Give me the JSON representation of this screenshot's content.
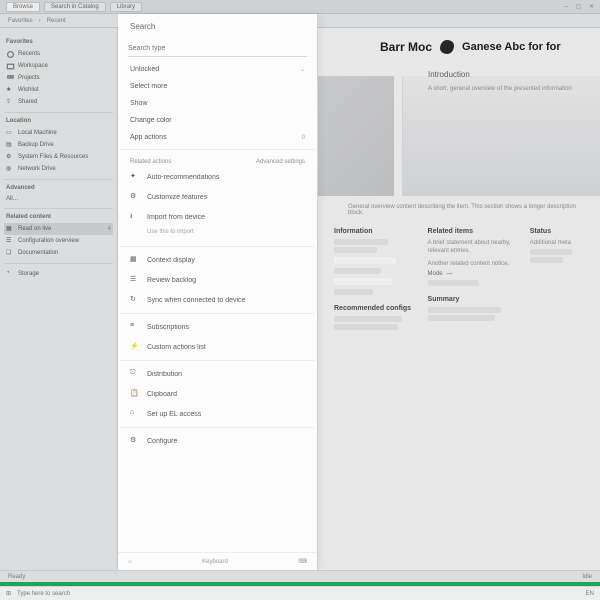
{
  "tabbar": {
    "tab1": "Browse",
    "tab2": "Search in Catalog",
    "tab3": "Library"
  },
  "toolbar": {
    "breadcrumb1": "Favorites",
    "breadcrumb2": "Recent"
  },
  "sidebar": {
    "group1_title": "Favorites",
    "items1": [
      {
        "label": "Recents"
      },
      {
        "label": "Workspace"
      },
      {
        "label": "Projects"
      },
      {
        "label": "Wishlist"
      },
      {
        "label": "Shared"
      }
    ],
    "group2_title": "Location",
    "items2": [
      {
        "label": "Local Machine"
      },
      {
        "label": "Backup Drive"
      },
      {
        "label": "System Files & Resources"
      },
      {
        "label": "Network Drive"
      }
    ],
    "group3_title": "Advanced",
    "items3": [
      {
        "label": "All…"
      }
    ],
    "group4_title": "Related content",
    "items4": [
      {
        "label": "Read on live",
        "meta": "4"
      },
      {
        "label": "Configuration overview"
      },
      {
        "label": "Documentation"
      }
    ],
    "bottom_label": "Storage"
  },
  "menu": {
    "title": "Search",
    "search_placeholder": "Search type",
    "item_unlocked": "Unlocked",
    "item_select_more": "Select more",
    "item_show": "Show",
    "item_changecolor": "Change color",
    "item_app_actions": "App actions",
    "item_app_actions_meta": "0",
    "heading_related": "Related actions",
    "heading_related_meta": "Advanced settings",
    "item_autorecommend": "Auto-recommendations",
    "item_customize": "Customize features",
    "item_import": "Import from device",
    "item_import_sub": "Use this to import",
    "item_context": "Context display",
    "item_review": "Review backlog",
    "item_sync": "Sync when connected to device",
    "item_subscriptions": "Subscriptions",
    "item_custom_actions": "Custom actions list",
    "item_distribution": "Distribution",
    "item_clipboard": "Clipboard",
    "item_setup_access": "Set up EL access",
    "item_configure": "Configure",
    "footer_label": "Keyboard"
  },
  "hero": {
    "title_left": "Barr Moc",
    "title_right": "Ganese Abc for for",
    "subtitle": "Introduction",
    "desc": "A short, general overview of the presented information"
  },
  "content": {
    "intro_heading": "Summary",
    "intro_text": "General overview content describing the item. This section shows a longer description block.",
    "col1_heading": "Information",
    "col2_heading": "Related items",
    "col3_heading": "Status",
    "col2_text1": "A brief statement about nearby, relevant entries.",
    "col2_text2": "Another related content notice.",
    "col2_field_label": "Mode",
    "col3_text": "Additional meta",
    "panel_heading": "Recommended configs",
    "field_value": "—"
  },
  "status": {
    "left": "Ready",
    "right": "Idle"
  },
  "taskbar": {
    "search_placeholder": "Type here to search",
    "right_label": "EN"
  }
}
